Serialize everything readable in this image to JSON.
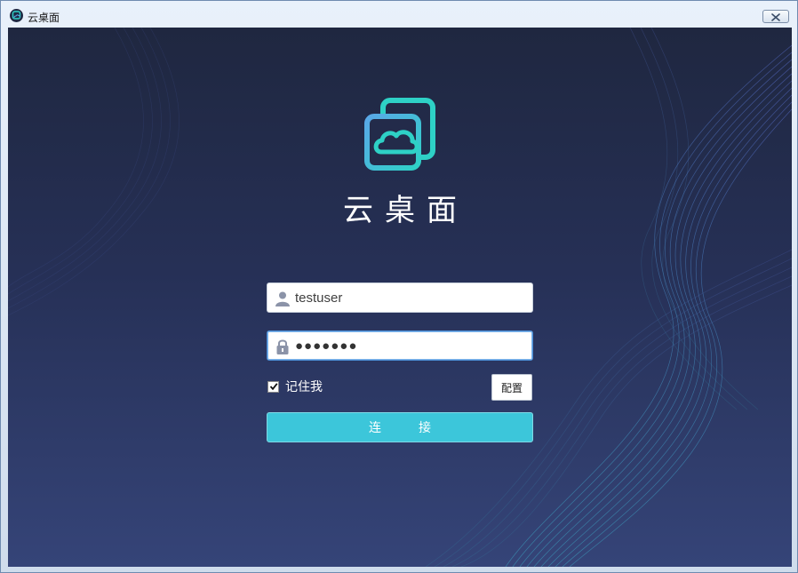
{
  "window": {
    "title": "云桌面",
    "close_icon": "close-icon",
    "app_icon": "cloud-desktop-app-icon"
  },
  "brand": {
    "logo_icon": "cloud-desktop-logo-icon",
    "name": "云桌面",
    "colors": {
      "logo_teal": "#2ed1c6",
      "logo_blue": "#5aa8e8"
    }
  },
  "login": {
    "username": {
      "value": "testuser",
      "icon": "user-icon"
    },
    "password": {
      "value": "●●●●●●●",
      "icon": "lock-icon"
    },
    "remember": {
      "label": "记住我",
      "checked": true
    },
    "config_label": "配置",
    "connect_label": "连接"
  },
  "colors": {
    "background_top": "#1f2740",
    "background_bottom": "#354478",
    "accent": "#3cc6da"
  }
}
